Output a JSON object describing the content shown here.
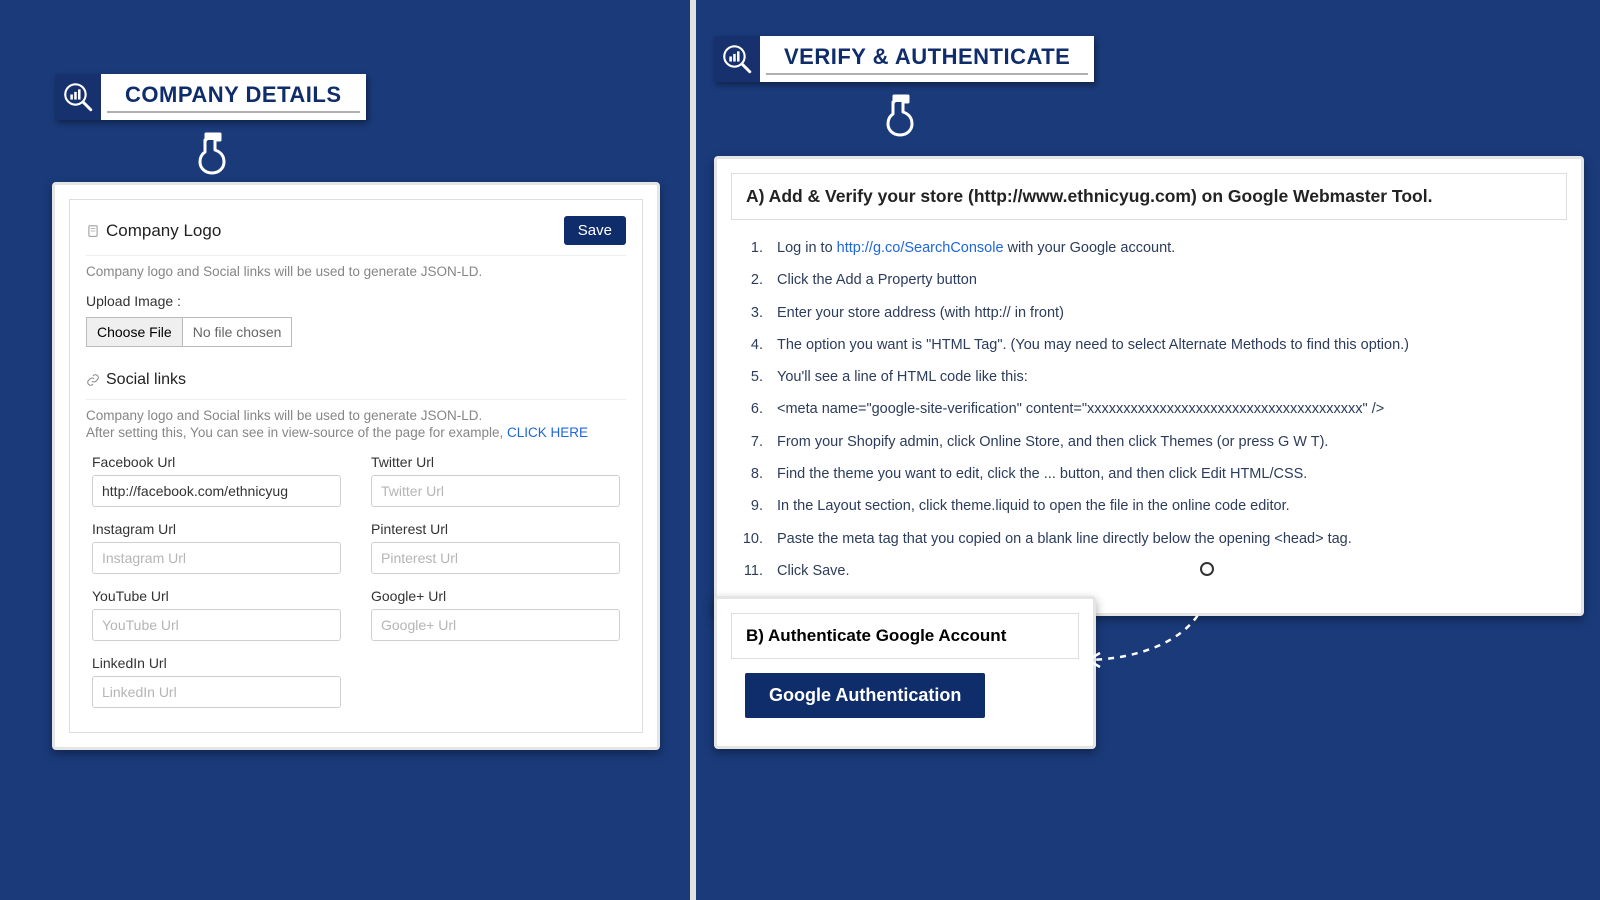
{
  "left": {
    "title": "COMPANY DETAILS",
    "logo": {
      "heading": "Company Logo",
      "save": "Save",
      "desc": "Company logo and Social links will be used to generate JSON-LD.",
      "upload_label": "Upload Image :",
      "choose_file": "Choose File",
      "no_file": "No file chosen"
    },
    "social": {
      "heading": "Social links",
      "desc1": "Company logo and Social links will be used to generate JSON-LD.",
      "desc2": "After setting this, You can see in view-source of the page for example, ",
      "cta": "CLICK HERE",
      "fields": {
        "facebook": {
          "label": "Facebook Url",
          "value": "http://facebook.com/ethnicyug",
          "placeholder": "Facebook Url"
        },
        "twitter": {
          "label": "Twitter Url",
          "value": "",
          "placeholder": "Twitter Url"
        },
        "instagram": {
          "label": "Instagram Url",
          "value": "",
          "placeholder": "Instagram Url"
        },
        "pinterest": {
          "label": "Pinterest Url",
          "value": "",
          "placeholder": "Pinterest Url"
        },
        "youtube": {
          "label": "YouTube Url",
          "value": "",
          "placeholder": "YouTube Url"
        },
        "googleplus": {
          "label": "Google+ Url",
          "value": "",
          "placeholder": "Google+ Url"
        },
        "linkedin": {
          "label": "LinkedIn Url",
          "value": "",
          "placeholder": "LinkedIn Url"
        }
      }
    }
  },
  "right": {
    "title": "VERIFY & AUTHENTICATE",
    "sectionA": {
      "heading": "A) Add & Verify your store (http://www.ethnicyug.com) on Google Webmaster Tool.",
      "steps": [
        {
          "n": "1.",
          "pre": "Log in to ",
          "link": "http://g.co/SearchConsole",
          "post": " with your Google account."
        },
        {
          "n": "2.",
          "text": "Click the Add a Property button"
        },
        {
          "n": "3.",
          "text": "Enter your store address (with http:// in front)"
        },
        {
          "n": "4.",
          "text": "The option you want is \"HTML Tag\". (You may need to select Alternate Methods to find this option.)"
        },
        {
          "n": "5.",
          "text": "You'll see a line of HTML code like this:"
        },
        {
          "n": "6.",
          "text": "<meta name=\"google-site-verification\" content=\"xxxxxxxxxxxxxxxxxxxxxxxxxxxxxxxxxxxxxx\" />"
        },
        {
          "n": "7.",
          "text": "From your Shopify admin, click Online Store, and then click Themes (or press G W T)."
        },
        {
          "n": "8.",
          "text": "Find the theme you want to edit, click the ... button, and then click Edit HTML/CSS."
        },
        {
          "n": "9.",
          "text": "In the Layout section, click theme.liquid to open the file in the online code editor."
        },
        {
          "n": "10.",
          "text": "Paste the meta tag that you copied on a blank line directly below the opening <head> tag."
        },
        {
          "n": "11.",
          "text": "Click Save."
        }
      ]
    },
    "sectionB": {
      "heading": "B) Authenticate Google Account",
      "button": "Google Authentication"
    }
  }
}
